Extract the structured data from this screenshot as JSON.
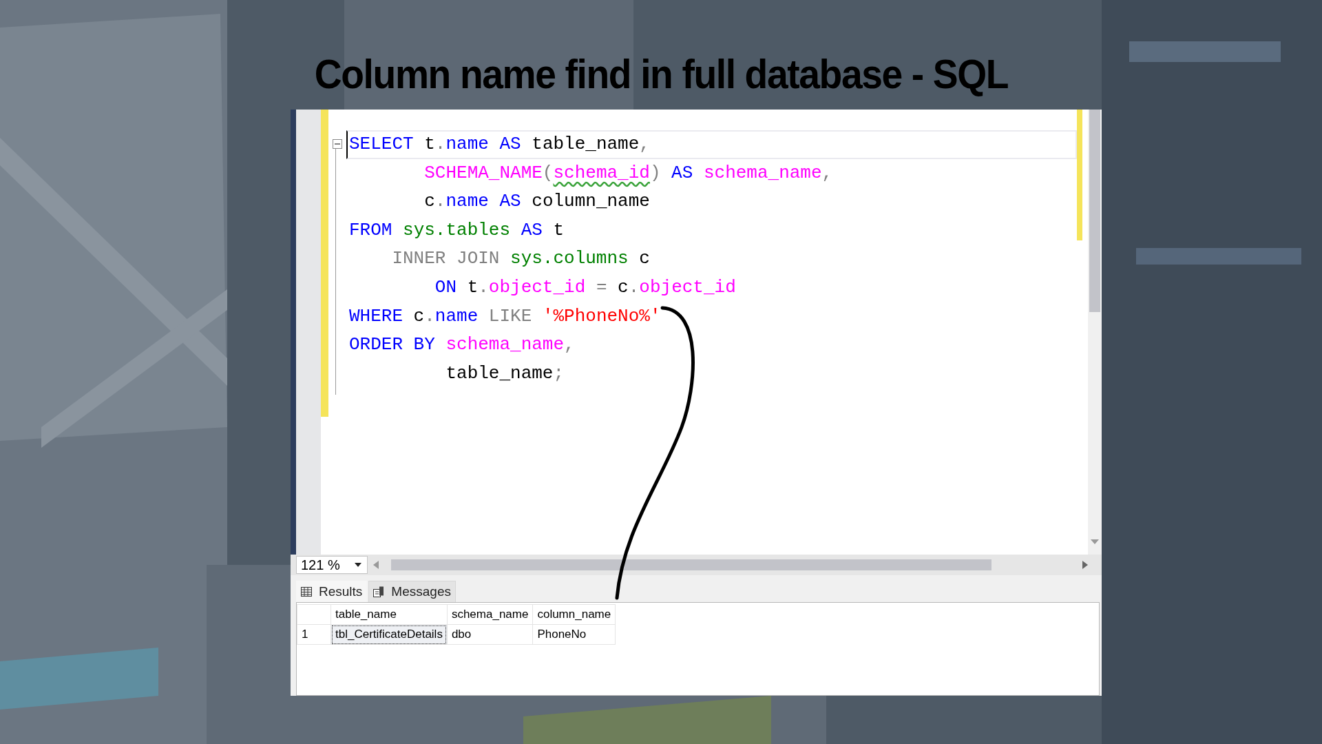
{
  "title": "Column name find in full database - SQL",
  "editor": {
    "fold_expanded": true,
    "lines": [
      {
        "current": true,
        "tokens": [
          {
            "text": "SELECT",
            "kind": "keyword",
            "squiggle": false
          },
          {
            "text": " t",
            "kind": "plain",
            "squiggle": false
          },
          {
            "text": ".",
            "kind": "operator",
            "squiggle": false
          },
          {
            "text": "name",
            "kind": "keyword",
            "squiggle": false
          },
          {
            "text": " AS",
            "kind": "keyword",
            "squiggle": false
          },
          {
            "text": " table_name",
            "kind": "plain",
            "squiggle": false
          },
          {
            "text": ",",
            "kind": "operator",
            "squiggle": false
          }
        ]
      },
      {
        "current": false,
        "tokens": [
          {
            "text": "       SCHEMA_NAME",
            "kind": "function",
            "squiggle": false
          },
          {
            "text": "(",
            "kind": "operator",
            "squiggle": false
          },
          {
            "text": "schema_id",
            "kind": "function",
            "squiggle": true
          },
          {
            "text": ")",
            "kind": "operator",
            "squiggle": false
          },
          {
            "text": " AS",
            "kind": "keyword",
            "squiggle": false
          },
          {
            "text": " schema_name",
            "kind": "function",
            "squiggle": false
          },
          {
            "text": ",",
            "kind": "operator",
            "squiggle": false
          }
        ]
      },
      {
        "current": false,
        "tokens": [
          {
            "text": "       c",
            "kind": "plain",
            "squiggle": false
          },
          {
            "text": ".",
            "kind": "operator",
            "squiggle": false
          },
          {
            "text": "name",
            "kind": "keyword",
            "squiggle": false
          },
          {
            "text": " AS",
            "kind": "keyword",
            "squiggle": false
          },
          {
            "text": " column_name",
            "kind": "plain",
            "squiggle": false
          }
        ]
      },
      {
        "current": false,
        "tokens": [
          {
            "text": "FROM",
            "kind": "keyword",
            "squiggle": false
          },
          {
            "text": " sys.tables",
            "kind": "object",
            "squiggle": false
          },
          {
            "text": " AS",
            "kind": "keyword",
            "squiggle": false
          },
          {
            "text": " t",
            "kind": "plain",
            "squiggle": false
          }
        ]
      },
      {
        "current": false,
        "tokens": [
          {
            "text": "    INNER JOIN",
            "kind": "operator",
            "squiggle": false
          },
          {
            "text": " sys.columns",
            "kind": "object",
            "squiggle": false
          },
          {
            "text": " c",
            "kind": "plain",
            "squiggle": false
          }
        ]
      },
      {
        "current": false,
        "tokens": [
          {
            "text": "        ON",
            "kind": "keyword",
            "squiggle": false
          },
          {
            "text": " t",
            "kind": "plain",
            "squiggle": false
          },
          {
            "text": ".",
            "kind": "operator",
            "squiggle": false
          },
          {
            "text": "object_id",
            "kind": "function",
            "squiggle": false
          },
          {
            "text": " =",
            "kind": "operator",
            "squiggle": false
          },
          {
            "text": " c",
            "kind": "plain",
            "squiggle": false
          },
          {
            "text": ".",
            "kind": "operator",
            "squiggle": false
          },
          {
            "text": "object_id",
            "kind": "function",
            "squiggle": false
          }
        ]
      },
      {
        "current": false,
        "tokens": [
          {
            "text": "WHERE",
            "kind": "keyword",
            "squiggle": false
          },
          {
            "text": " c",
            "kind": "plain",
            "squiggle": false
          },
          {
            "text": ".",
            "kind": "operator",
            "squiggle": false
          },
          {
            "text": "name",
            "kind": "keyword",
            "squiggle": false
          },
          {
            "text": " LIKE",
            "kind": "operator",
            "squiggle": false
          },
          {
            "text": " '%PhoneNo%'",
            "kind": "string",
            "squiggle": false
          }
        ]
      },
      {
        "current": false,
        "tokens": [
          {
            "text": "ORDER BY",
            "kind": "keyword",
            "squiggle": false
          },
          {
            "text": " schema_name",
            "kind": "function",
            "squiggle": false
          },
          {
            "text": ",",
            "kind": "operator",
            "squiggle": false
          }
        ]
      },
      {
        "current": false,
        "tokens": [
          {
            "text": "         table_name",
            "kind": "plain",
            "squiggle": false
          },
          {
            "text": ";",
            "kind": "operator",
            "squiggle": false
          }
        ]
      }
    ]
  },
  "zoom": "121 %",
  "result_tabs": [
    {
      "label": "Results",
      "selected": true
    },
    {
      "label": "Messages",
      "selected": false
    }
  ],
  "grid": {
    "columns": [
      "table_name",
      "schema_name",
      "column_name"
    ],
    "rows": [
      {
        "number": "1",
        "cells": [
          {
            "text": "tbl_CertificateDetails",
            "selected": true
          },
          {
            "text": "dbo",
            "selected": false
          },
          {
            "text": "PhoneNo",
            "selected": false
          }
        ]
      }
    ]
  }
}
